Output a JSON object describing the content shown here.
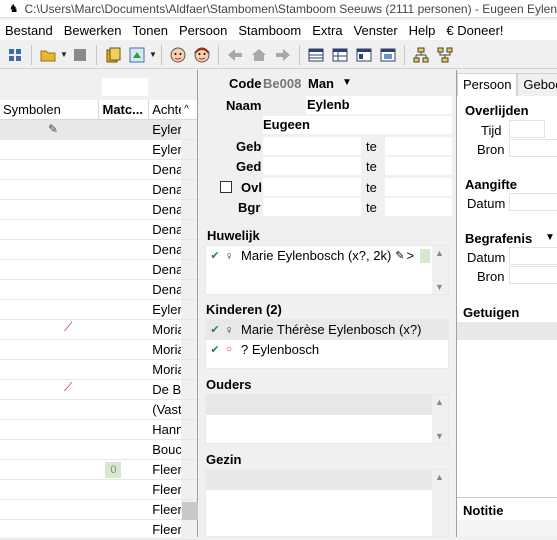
{
  "window": {
    "title": "C:\\Users\\Marc\\Documents\\Aldfaer\\Stambomen\\Stamboom Seeuws (2111 personen) - Eugeen Eylen"
  },
  "menu": [
    "Bestand",
    "Bewerken",
    "Tonen",
    "Persoon",
    "Stamboom",
    "Extra",
    "Venster",
    "Help",
    "€ Doneer!"
  ],
  "toolbar_icons": [
    "app-grid-icon",
    "open-folder-icon",
    "dropdown-icon",
    "stop-icon",
    "copy-book-icon",
    "tree-export-icon",
    "dropdown-icon",
    "male-face-icon",
    "female-face-icon",
    "back-arrow-icon",
    "home-icon",
    "forward-arrow-icon",
    "table-view-icon",
    "grid-view-icon",
    "card-view-icon",
    "image-view-icon",
    "tree-icon",
    "family-tree-icon"
  ],
  "left_list": {
    "headers": {
      "symbols": "Symbolen",
      "match": "Matc...",
      "achter": "Achte",
      "sort": "^"
    },
    "rows": [
      {
        "symbol": "pen",
        "match": "",
        "name": "Eyler"
      },
      {
        "symbol": "",
        "match": "",
        "name": "Eyler"
      },
      {
        "symbol": "",
        "match": "",
        "name": "Dena"
      },
      {
        "symbol": "",
        "match": "",
        "name": "Dena"
      },
      {
        "symbol": "",
        "match": "",
        "name": "Dena"
      },
      {
        "symbol": "",
        "match": "",
        "name": "Dena"
      },
      {
        "symbol": "",
        "match": "",
        "name": "Dena"
      },
      {
        "symbol": "",
        "match": "",
        "name": "Dena"
      },
      {
        "symbol": "",
        "match": "",
        "name": "Dena"
      },
      {
        "symbol": "",
        "match": "",
        "name": "Eyler"
      },
      {
        "symbol": "pin",
        "match": "",
        "name": "Moria"
      },
      {
        "symbol": "",
        "match": "",
        "name": "Moria"
      },
      {
        "symbol": "",
        "match": "",
        "name": "Moria"
      },
      {
        "symbol": "pin",
        "match": "",
        "name": "De Br"
      },
      {
        "symbol": "",
        "match": "",
        "name": "(Vast"
      },
      {
        "symbol": "",
        "match": "",
        "name": "Hann"
      },
      {
        "symbol": "",
        "match": "",
        "name": "Bouc"
      },
      {
        "symbol": "",
        "match": "0",
        "name": "Fleer"
      },
      {
        "symbol": "",
        "match": "",
        "name": "Fleer"
      },
      {
        "symbol": "",
        "match": "",
        "name": "Fleer"
      },
      {
        "symbol": "",
        "match": "",
        "name": "Fleer"
      }
    ]
  },
  "person": {
    "code_label": "Code",
    "code_value": "Be008",
    "sex": "Man",
    "naam_label": "Naam",
    "naam_value": "Eylenb",
    "voornaam_value": "Eugeen",
    "events": [
      {
        "label": "Geb",
        "te": "te",
        "checkbox": false
      },
      {
        "label": "Ged",
        "te": "te",
        "checkbox": false
      },
      {
        "label": "Ovl",
        "te": "te",
        "checkbox": true
      },
      {
        "label": "Bgr",
        "te": "te",
        "checkbox": false
      }
    ]
  },
  "huwelijk": {
    "label": "Huwelijk",
    "rows": [
      {
        "name": "Marie Eylenbosch (x?, 2k)",
        "suffix": ">"
      }
    ]
  },
  "kinderen": {
    "label": "Kinderen (2)",
    "rows": [
      {
        "sex": "female",
        "name": "Marie Thérèse Eylenbosch (x?)"
      },
      {
        "sex": "unknown",
        "name": "? Eylenbosch"
      }
    ]
  },
  "ouders": {
    "label": "Ouders"
  },
  "gezin": {
    "label": "Gezin"
  },
  "right": {
    "tabs": [
      "Persoon",
      "Geboo"
    ],
    "overlijden": "Overlijden",
    "tijd": "Tijd",
    "bron1": "Bron",
    "aangifte": "Aangifte",
    "datum1": "Datum",
    "begrafenis": "Begrafenis",
    "datum2": "Datum",
    "bron2": "Bron",
    "getuigen": "Getuigen",
    "notitie": "Notitie"
  }
}
